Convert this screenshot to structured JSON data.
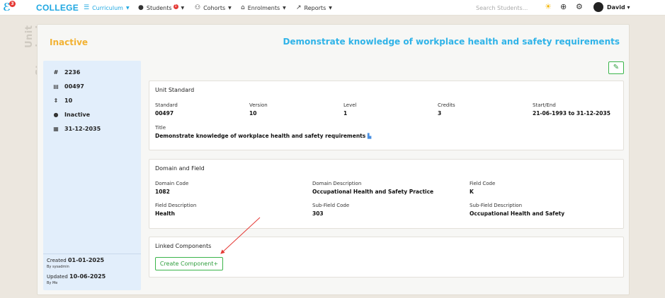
{
  "nav": {
    "logo_badge": "3",
    "brand": "COLLEGE",
    "items": [
      {
        "label": "Curriculum",
        "icon": "☰",
        "active": true
      },
      {
        "label": "Students",
        "icon": "👤",
        "badge": "1"
      },
      {
        "label": "Cohorts",
        "icon": "👥"
      },
      {
        "label": "Enrolments",
        "icon": "🎓"
      },
      {
        "label": "Reports",
        "icon": "📈"
      }
    ],
    "search_placeholder": "Search Students...",
    "user_name": "David"
  },
  "watermark": "Unit Standard",
  "header": {
    "status": "Inactive",
    "title": "Demonstrate knowledge of workplace health and safety requirements"
  },
  "info_panel": {
    "rows": [
      {
        "icon": "#",
        "value": "2236"
      },
      {
        "icon": "▤",
        "value": "00497"
      },
      {
        "icon": "⇕",
        "value": "10"
      },
      {
        "icon": "❓",
        "value": "Inactive"
      },
      {
        "icon": "▦",
        "value": "31-12-2035"
      }
    ],
    "created_label": "Created",
    "created_date": "01-01-2025",
    "created_by": "By sysadmin",
    "updated_label": "Updated",
    "updated_date": "10-06-2025",
    "updated_by": "By Me"
  },
  "unit_standard": {
    "title": "Unit Standard",
    "standard_label": "Standard",
    "standard_value": "00497",
    "version_label": "Version",
    "version_value": "10",
    "level_label": "Level",
    "level_value": "1",
    "credits_label": "Credits",
    "credits_value": "3",
    "startend_label": "Start/End",
    "startend_value": "21-06-1993 to 31-12-2035",
    "title_label": "Title",
    "title_value": "Demonstrate knowledge of workplace health and safety requirements"
  },
  "domain_field": {
    "title": "Domain and Field",
    "domain_code_label": "Domain Code",
    "domain_code_value": "1082",
    "domain_desc_label": "Domain Description",
    "domain_desc_value": "Occupational Health and Safety Practice",
    "field_code_label": "Field Code",
    "field_code_value": "K",
    "field_desc_label": "Field Description",
    "field_desc_value": "Health",
    "subfield_code_label": "Sub-Field Code",
    "subfield_code_value": "303",
    "subfield_desc_label": "Sub-Field Description",
    "subfield_desc_value": "Occupational Health and Safety"
  },
  "linked": {
    "title": "Linked Components",
    "create_label": "Create Component+"
  },
  "colors": {
    "accent": "#1ea7e1",
    "status": "#f2b233",
    "success": "#3bb54a",
    "annotation_arrow": "#e53935"
  }
}
